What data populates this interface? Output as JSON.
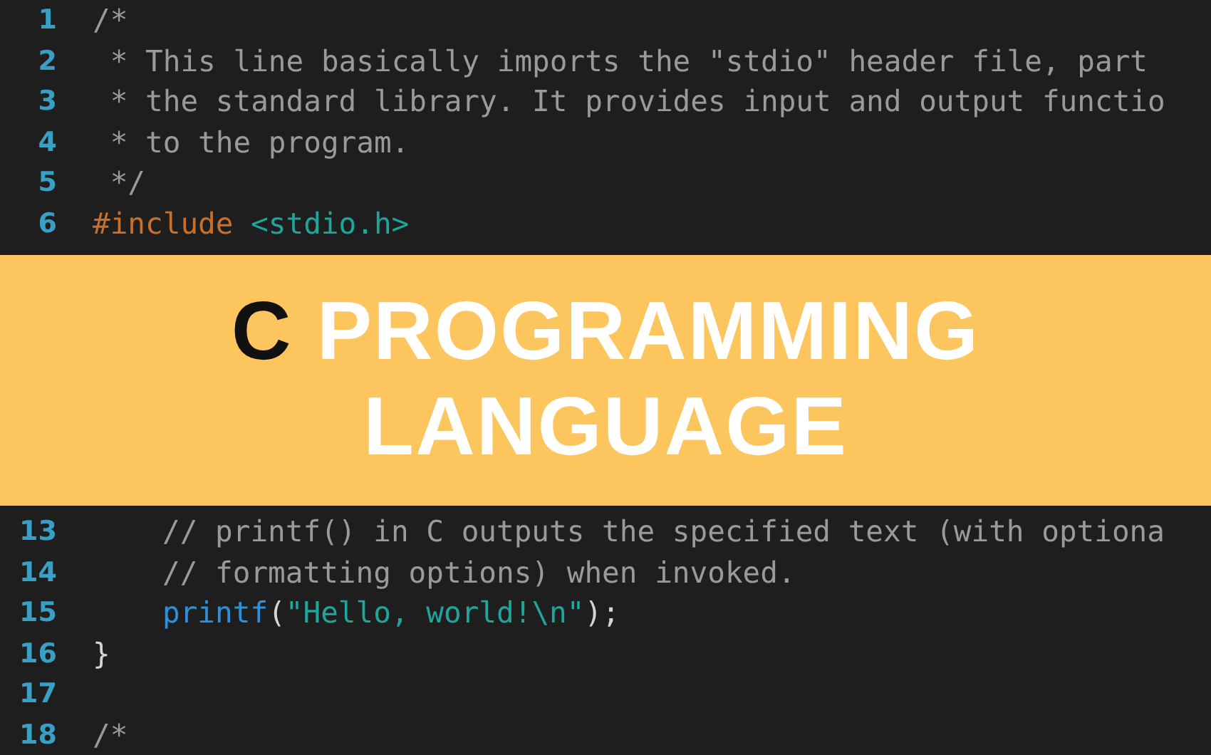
{
  "code_top": [
    {
      "number": "1",
      "tokens": [
        {
          "kind": "comment",
          "text": "/*"
        }
      ]
    },
    {
      "number": "2",
      "tokens": [
        {
          "kind": "comment",
          "text": " * This line basically imports the \"stdio\" header file, part"
        }
      ]
    },
    {
      "number": "3",
      "tokens": [
        {
          "kind": "comment",
          "text": " * the standard library. It provides input and output functio"
        }
      ]
    },
    {
      "number": "4",
      "tokens": [
        {
          "kind": "comment",
          "text": " * to the program."
        }
      ]
    },
    {
      "number": "5",
      "tokens": [
        {
          "kind": "comment",
          "text": " */"
        }
      ]
    },
    {
      "number": "6",
      "tokens": [
        {
          "kind": "preprocessor",
          "text": "#include"
        },
        {
          "kind": "string",
          "text": "<stdio.h>",
          "space_before": true
        }
      ]
    }
  ],
  "banner": {
    "title": [
      {
        "kind": "dark",
        "text": "C"
      },
      {
        "kind": "light",
        "text": "PROGRAMMING"
      },
      {
        "kind": "light",
        "text": "LANGUAGE"
      }
    ]
  },
  "code_bottom": [
    {
      "number": "13",
      "indented": true,
      "tokens": [
        {
          "kind": "comment",
          "text": "// printf() in C outputs the specified text (with optiona"
        }
      ]
    },
    {
      "number": "14",
      "indented": true,
      "tokens": [
        {
          "kind": "comment",
          "text": "// formatting options) when invoked."
        }
      ]
    },
    {
      "number": "15",
      "indented": true,
      "tokens": [
        {
          "kind": "function",
          "text": "printf"
        },
        {
          "kind": "plain",
          "text": "("
        },
        {
          "kind": "string",
          "text": "\"Hello, world!\\n\""
        },
        {
          "kind": "plain",
          "text": ");"
        }
      ]
    },
    {
      "number": "16",
      "tokens": [
        {
          "kind": "plain",
          "text": "}"
        }
      ]
    },
    {
      "number": "17"
    },
    {
      "number": "18",
      "tokens": [
        {
          "kind": "comment",
          "text": "/*"
        }
      ]
    }
  ]
}
